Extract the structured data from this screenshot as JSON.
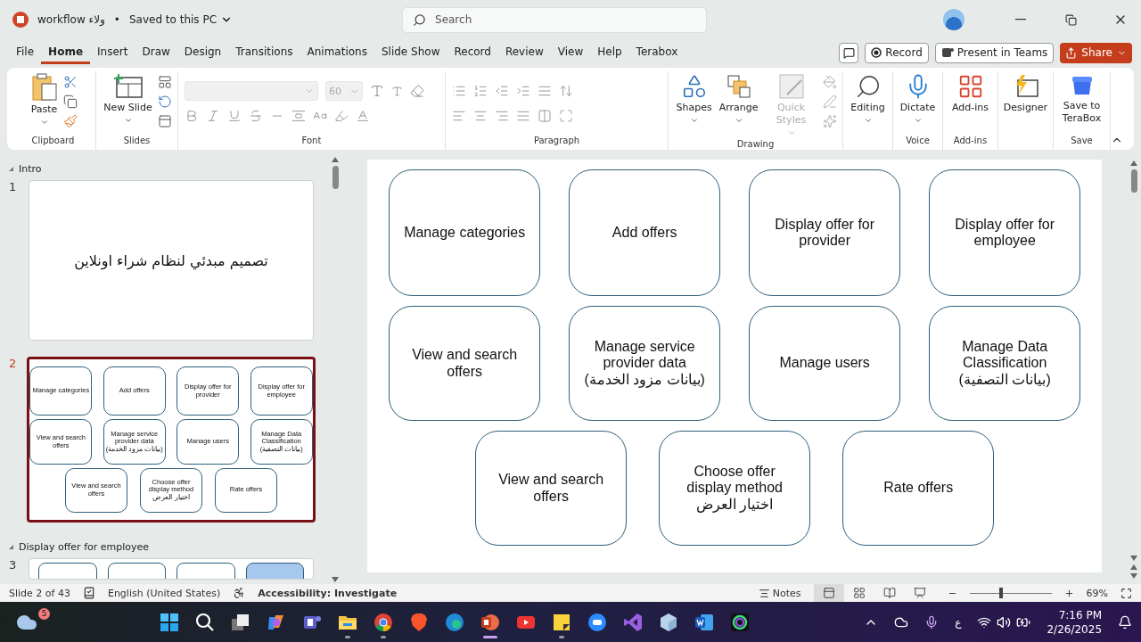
{
  "title_bar": {
    "document": "workflow ولاء",
    "separator": "•",
    "save_status": "Saved to this PC",
    "search": {
      "placeholder": "Search"
    }
  },
  "menu_tabs": [
    {
      "label": "File",
      "selected": false
    },
    {
      "label": "Home",
      "selected": true
    },
    {
      "label": "Insert",
      "selected": false
    },
    {
      "label": "Draw",
      "selected": false
    },
    {
      "label": "Design",
      "selected": false
    },
    {
      "label": "Transitions",
      "selected": false
    },
    {
      "label": "Animations",
      "selected": false
    },
    {
      "label": "Slide Show",
      "selected": false
    },
    {
      "label": "Record",
      "selected": false
    },
    {
      "label": "Review",
      "selected": false
    },
    {
      "label": "View",
      "selected": false
    },
    {
      "label": "Help",
      "selected": false
    },
    {
      "label": "Terabox",
      "selected": false
    }
  ],
  "header_buttons": {
    "record": "Record",
    "teams": "Present in Teams",
    "share": "Share"
  },
  "ribbon": {
    "font_size": "60",
    "groups": [
      {
        "kind": "clipboard",
        "label": "Clipboard",
        "buttons": [
          {
            "label": "Paste",
            "disabled": false
          }
        ]
      },
      {
        "kind": "slides",
        "label": "Slides",
        "buttons": [
          {
            "label": "New Slide",
            "disabled": false
          }
        ]
      },
      {
        "kind": "font",
        "label": "Font"
      },
      {
        "kind": "paragraph",
        "label": "Paragraph"
      },
      {
        "kind": "drawing",
        "label": "Drawing",
        "buttons": [
          {
            "label": "Shapes",
            "disabled": false
          },
          {
            "label": "Arrange",
            "disabled": false
          },
          {
            "label": "Quick Styles",
            "disabled": true
          }
        ]
      },
      {
        "kind": "editing",
        "buttons": [
          {
            "label": "Editing",
            "disabled": false
          }
        ]
      },
      {
        "kind": "voice",
        "label": "Voice",
        "buttons": [
          {
            "label": "Dictate",
            "disabled": false
          }
        ]
      },
      {
        "kind": "addins",
        "label": "Add-ins",
        "buttons": [
          {
            "label": "Add-ins",
            "disabled": false
          }
        ]
      },
      {
        "kind": "designer",
        "buttons": [
          {
            "label": "Designer",
            "disabled": false
          }
        ]
      },
      {
        "kind": "save",
        "label": "Save",
        "buttons": [
          {
            "label": "Save to TeraBox",
            "disabled": false
          }
        ]
      }
    ]
  },
  "slide_panel": {
    "sections": [
      {
        "title": "Intro",
        "slides": [
          {
            "number": "1",
            "selected": false,
            "kind": "title",
            "title": "تصميم مبدئي لنظام شراء اونلاين"
          },
          {
            "number": "2",
            "selected": true,
            "kind": "boxes",
            "rows": [
              [
                {
                  "text": "Manage categories"
                },
                {
                  "text": "Add offers"
                },
                {
                  "text": "Display offer for provider"
                },
                {
                  "text": "Display offer for employee"
                }
              ],
              [
                {
                  "text": "View and search offers"
                },
                {
                  "text": "Manage service provider data",
                  "subtext": "(بيانات مزود الخدمة)"
                },
                {
                  "text": "Manage users"
                },
                {
                  "text": "Manage Data Classification",
                  "subtext": "(بيانات التصفية)"
                }
              ],
              [
                {
                  "text": "View and search offers"
                },
                {
                  "text": "Choose offer display method",
                  "subtext": "اختيار العرض"
                },
                {
                  "text": "Rate offers"
                }
              ]
            ]
          }
        ]
      },
      {
        "title": "Display offer for employee",
        "slides": [
          {
            "number": "3",
            "selected": false,
            "kind": "partial"
          }
        ]
      }
    ]
  },
  "slide": {
    "rows": [
      [
        {
          "text": "Manage categories"
        },
        {
          "text": "Add offers"
        },
        {
          "text": "Display offer for provider"
        },
        {
          "text": "Display offer for employee"
        }
      ],
      [
        {
          "text": "View and search offers"
        },
        {
          "text": "Manage service provider data",
          "subtext": "(بيانات مزود الخدمة)"
        },
        {
          "text": "Manage users"
        },
        {
          "text": "Manage Data Classification",
          "subtext": "(بيانات التصفية)"
        }
      ],
      [
        {
          "text": "View and search offers"
        },
        {
          "text": "Choose offer display method",
          "subtext": "اختيار العرض"
        },
        {
          "text": "Rate offers"
        }
      ]
    ]
  },
  "status_bar": {
    "slide_count": "Slide 2 of 43",
    "language": "English (United States)",
    "accessibility": "Accessibility: Investigate",
    "notes": "Notes",
    "views": [
      {
        "kind": "normal",
        "selected": true
      },
      {
        "kind": "sorter",
        "selected": false
      },
      {
        "kind": "reading",
        "selected": false
      },
      {
        "kind": "show",
        "selected": false
      }
    ],
    "zoom": {
      "level": 0.38,
      "reading": "69%"
    }
  },
  "taskbar": {
    "weather_badge": "5",
    "input_language": "ع",
    "time": "7:16 PM",
    "date": "2/26/2025",
    "apps": [
      {
        "kind": "start",
        "running": false,
        "selected": false
      },
      {
        "kind": "search",
        "running": false,
        "selected": false
      },
      {
        "kind": "taskview",
        "running": false,
        "selected": false
      },
      {
        "kind": "copilot",
        "running": false,
        "selected": false
      },
      {
        "kind": "teams",
        "running": false,
        "selected": false
      },
      {
        "kind": "explorer",
        "running": true,
        "selected": false
      },
      {
        "kind": "chrome",
        "running": true,
        "selected": false
      },
      {
        "kind": "brave",
        "running": false,
        "selected": false
      },
      {
        "kind": "edge",
        "running": false,
        "selected": false
      },
      {
        "kind": "powerpoint",
        "running": true,
        "selected": true
      },
      {
        "kind": "youtube",
        "running": false,
        "selected": false
      },
      {
        "kind": "sticky",
        "running": true,
        "selected": false
      },
      {
        "kind": "zoom",
        "running": false,
        "selected": false
      },
      {
        "kind": "studio",
        "running": false,
        "selected": false
      },
      {
        "kind": "cube",
        "running": false,
        "selected": false
      },
      {
        "kind": "word",
        "running": false,
        "selected": false
      },
      {
        "kind": "ring",
        "running": false,
        "selected": false
      }
    ]
  }
}
